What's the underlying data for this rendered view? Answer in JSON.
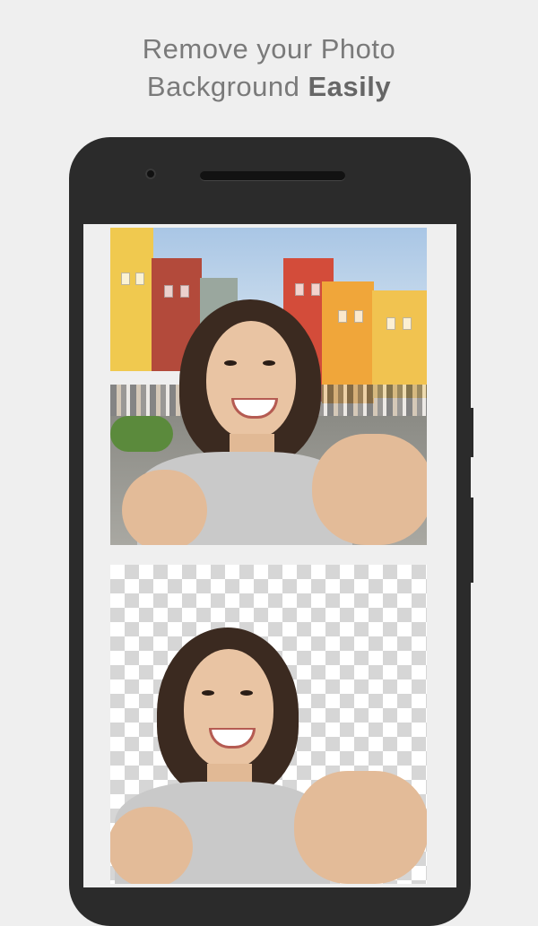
{
  "headline": {
    "line1": "Remove your Photo",
    "line2_prefix": "Background ",
    "line2_bold": "Easily"
  },
  "colors": {
    "page_background": "#efefef",
    "phone_body": "#2b2b2b",
    "headline_text": "#7a7a7a"
  },
  "screen": {
    "original_photo": "selfie with colorful buildings background",
    "result_photo": "selfie with transparent checkerboard background"
  }
}
